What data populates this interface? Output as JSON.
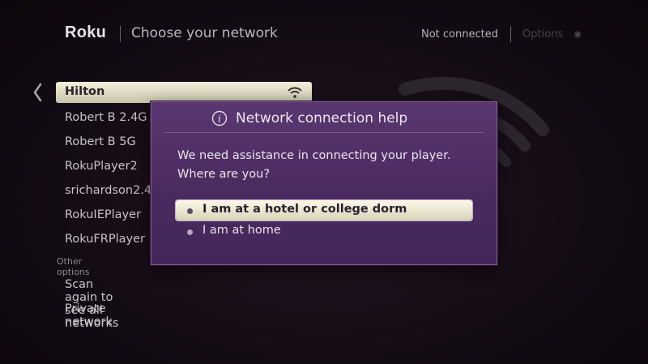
{
  "header": {
    "brand": "Roku",
    "title": "Choose your network",
    "status": "Not connected",
    "options_label": "Options",
    "options_icon": "asterisk-icon"
  },
  "networks": [
    {
      "name": "Hilton",
      "selected": true,
      "icon": "wifi-icon"
    },
    {
      "name": "Robert B 2.4G"
    },
    {
      "name": "Robert B 5G"
    },
    {
      "name": "RokuPlayer2"
    },
    {
      "name": "srichardson2.4"
    },
    {
      "name": "RokuIEPlayer"
    },
    {
      "name": "RokuFRPlayer"
    }
  ],
  "other_options": {
    "label": "Other options",
    "items": [
      "Scan again to see all networks",
      "Private network"
    ]
  },
  "dialog": {
    "title": "Network connection help",
    "message": "We need assistance in connecting your player.\nWhere are you?",
    "choices": [
      {
        "label": "I am at a hotel or college dorm",
        "selected": true
      },
      {
        "label": "I am at home",
        "selected": false
      }
    ]
  },
  "colors": {
    "dialog_bg": "#4a2b5f",
    "highlight": "#f3efd9",
    "background": "#150c15"
  }
}
